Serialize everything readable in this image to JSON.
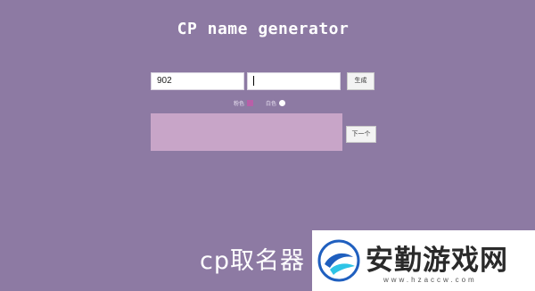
{
  "app": {
    "title": "CP name generator"
  },
  "form": {
    "name1_value": "902",
    "name2_value": "",
    "generate_label": "生成",
    "next_label": "下一个"
  },
  "options": [
    {
      "label": "粉色",
      "swatch": "#b95fa8"
    },
    {
      "label": "白色",
      "swatch": "#ffffff"
    }
  ],
  "result": {
    "text": ""
  },
  "footer": {
    "title": "cp取名器"
  },
  "watermark": {
    "text": "安勤游戏网",
    "url": "www.hzaccw.com"
  },
  "colors": {
    "background": "#8d7aa3",
    "result_box": "#c8a5c8"
  }
}
